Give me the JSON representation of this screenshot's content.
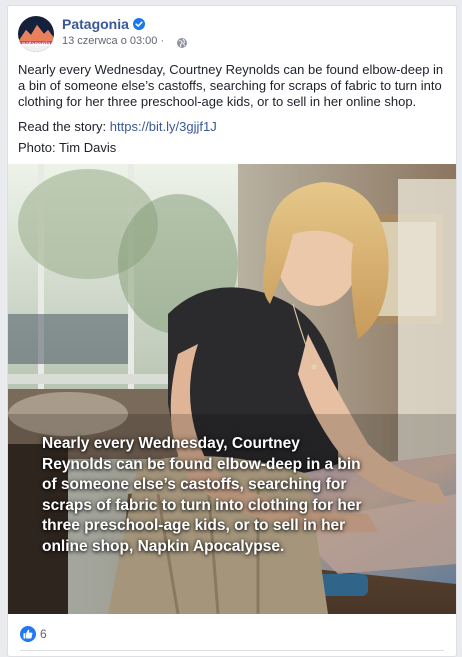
{
  "post": {
    "page_name": "Patagonia",
    "avatar_text": "patagonia",
    "timestamp": "13 czerwca o 03:00",
    "separator": "·",
    "body": "Nearly every Wednesday, Courtney Reynolds can be found elbow-deep in a bin of someone else’s castoffs, searching for scraps of fabric to turn into clothing for her three preschool-age kids, or to sell in her online shop.",
    "story_prefix": "Read the story: ",
    "story_link": "https://bit.ly/3gjjf1J",
    "photo_credit": "Photo: Tim Davis",
    "image_overlay": "Nearly every Wednesday, Courtney Reynolds can be found elbow-deep in a bin of someone else’s castoffs, searching for scraps of fabric to turn into clothing for her three preschool-age kids, or to sell in her online shop, Napkin Apocalypse.",
    "reaction_count": "6"
  },
  "icons": {
    "verified": "verified-badge-icon",
    "audience": "globe-icon",
    "reaction": "like-icon"
  },
  "colors": {
    "link": "#385898",
    "verified": "#1877f2",
    "like": "#2078f4"
  }
}
